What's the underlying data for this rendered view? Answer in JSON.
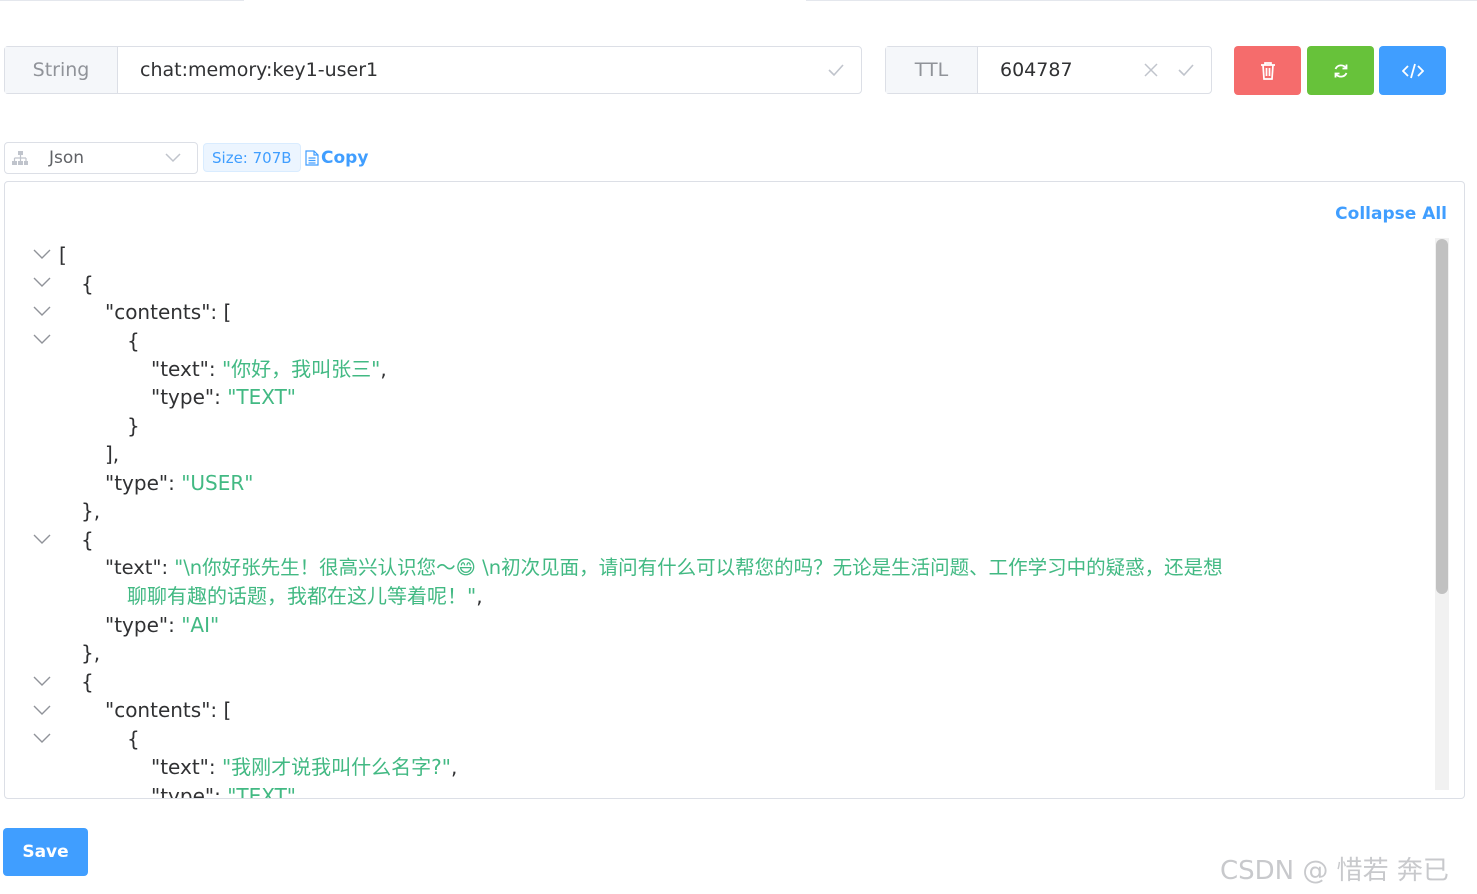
{
  "key": {
    "type_label": "String",
    "value": "chat:memory:key1-user1"
  },
  "ttl": {
    "label": "TTL",
    "value": "604787"
  },
  "actions": {
    "delete_icon": "trash-icon",
    "refresh_icon": "refresh-icon",
    "code_icon": "code-icon",
    "colors": {
      "delete": "#f56c6c",
      "refresh": "#67c23a",
      "code": "#409eff"
    }
  },
  "viewer": {
    "format": "Json",
    "size": "Size: 707B",
    "copy_label": "Copy",
    "collapse_all": "Collapse All"
  },
  "json_lines": [
    {
      "text": "["
    },
    {
      "text": "{"
    },
    {
      "key": "\"contents\"",
      "rest": ": ["
    },
    {
      "text": "{"
    },
    {
      "key": "\"text\"",
      "sep": ": ",
      "str": "\"你好，我叫张三\"",
      "tail": ","
    },
    {
      "key": "\"type\"",
      "sep": ": ",
      "str": "\"TEXT\""
    },
    {
      "text": "}"
    },
    {
      "text": "],"
    },
    {
      "key": "\"type\"",
      "sep": ": ",
      "str": "\"USER\""
    },
    {
      "text": "},"
    },
    {
      "text": "{"
    },
    {
      "key": "\"text\"",
      "sep": ": ",
      "str": "\"\\n你好张先生！很高兴认识您～😄  \\n初次见面，请问有什么可以帮您的吗？无论是生活问题、工作学习中的疑惑，还是想"
    },
    {
      "str": "聊聊有趣的话题，我都在这儿等着呢！\"",
      "tail": ","
    },
    {
      "key": "\"type\"",
      "sep": ": ",
      "str": "\"AI\""
    },
    {
      "text": "},"
    },
    {
      "text": "{"
    },
    {
      "key": "\"contents\"",
      "rest": ": ["
    },
    {
      "text": "{"
    },
    {
      "key": "\"text\"",
      "sep": ": ",
      "str": "\"我刚才说我叫什么名字?\"",
      "tail": ","
    },
    {
      "key": "\"type\"",
      "sep": ": ",
      "str": "\"TEXT\""
    }
  ],
  "save_label": "Save",
  "watermark": "CSDN @ 惜若 奔已"
}
